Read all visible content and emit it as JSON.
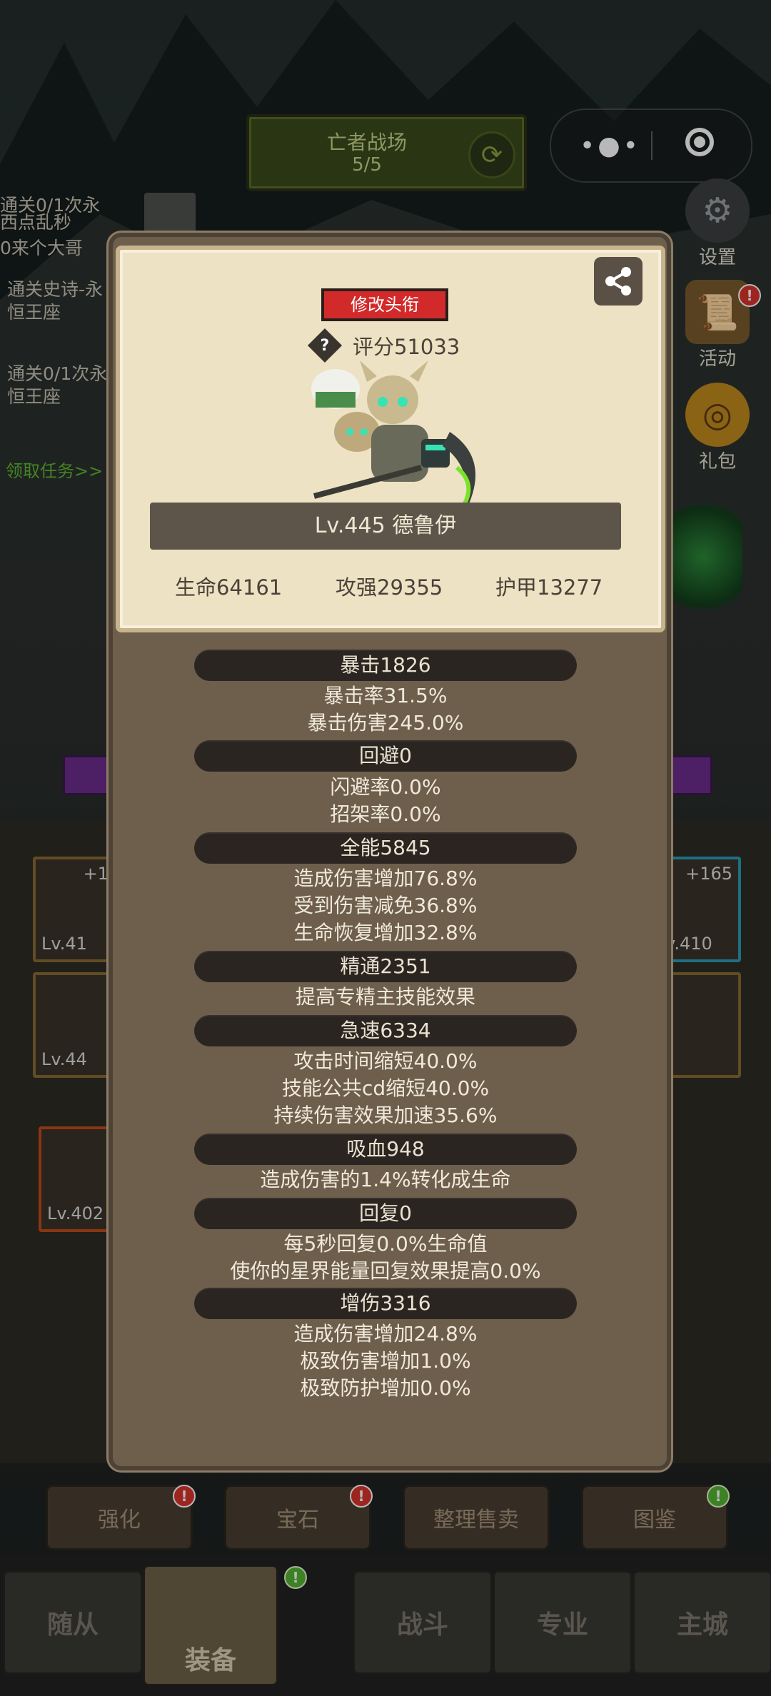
{
  "top": {
    "battle_title": "亡者战场",
    "battle_count": "5/5"
  },
  "quests": [
    {
      "text": "通关0/1次永"
    },
    {
      "text": "西点乱秒"
    },
    {
      "text": "0来个大哥"
    },
    {
      "text": "通关史诗-永"
    },
    {
      "text": "恒王座"
    },
    {
      "text": "通关0/1次永"
    },
    {
      "text": "恒王座"
    }
  ],
  "quest_link": "领取任务>>",
  "side": {
    "settings": "设置",
    "activity": "活动",
    "gift": "礼包"
  },
  "profile": {
    "edit_title": "修改头衔",
    "score": "评分51033",
    "name": "Lv.445 德鲁伊",
    "hp": "生命64161",
    "attack": "攻强29355",
    "armor": "护甲13277"
  },
  "stats": [
    {
      "header": "暴击1826",
      "lines": [
        "暴击率31.5%",
        "暴击伤害245.0%"
      ]
    },
    {
      "header": "回避0",
      "lines": [
        "闪避率0.0%",
        "招架率0.0%"
      ]
    },
    {
      "header": "全能5845",
      "lines": [
        "造成伤害增加76.8%",
        "受到伤害减免36.8%",
        "生命恢复增加32.8%"
      ]
    },
    {
      "header": "精通2351",
      "lines": [
        "提高专精主技能效果"
      ]
    },
    {
      "header": "急速6334",
      "lines": [
        "攻击时间缩短40.0%",
        "技能公共cd缩短40.0%",
        "持续伤害效果加速35.6%"
      ]
    },
    {
      "header": "吸血948",
      "lines": [
        "造成伤害的1.4%转化成生命"
      ]
    },
    {
      "header": "回复0",
      "lines": [
        "每5秒回复0.0%生命值",
        "使你的星界能量回复效果提高0.0%"
      ]
    },
    {
      "header": "增伤3316",
      "lines": [
        "造成伤害增加24.8%",
        "极致伤害增加1.0%",
        "极致防护增加0.0%"
      ]
    }
  ],
  "equip": {
    "slot1_lv": "Lv.41",
    "slot1_plus": "+1",
    "slot2_lv": "Lv.44",
    "slot3_lv": "Lv.402",
    "slot4_lv": "v.410",
    "slot4_plus": "+165"
  },
  "actions": [
    "强化",
    "宝石",
    "整理售卖",
    "图鉴"
  ],
  "tabs": [
    "随从",
    "装备",
    "战斗",
    "专业",
    "主城"
  ],
  "colors": {
    "accent_red": "#d22a2a",
    "badge_green": "#54b532",
    "panel": "#eee2c4"
  }
}
